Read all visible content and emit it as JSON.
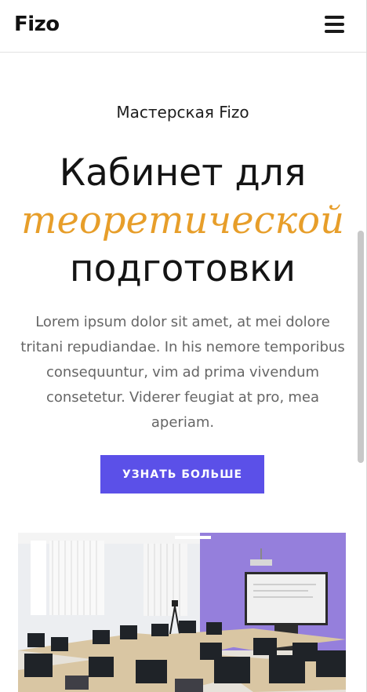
{
  "header": {
    "logo": "Fizo",
    "menu_icon": "hamburger-menu-icon"
  },
  "hero": {
    "eyebrow": "Мастерская Fizo",
    "title_line1": "Кабинет для",
    "title_line2": "теоретической",
    "title_line3": "подготовки",
    "description": "Lorem ipsum dolor sit amet, at mei dolore tritani repudiandae. In his nemore temporibus consequuntur, vim ad prima vivendum consetetur. Viderer feugiat at pro, mea aperiam.",
    "cta_label": "УЗНАТЬ БОЛЬШЕ"
  },
  "colors": {
    "accent_text": "#e79e2a",
    "button_bg": "#5b50e8",
    "button_text": "#ffffff",
    "heading": "#141414",
    "body_text": "#666666"
  }
}
